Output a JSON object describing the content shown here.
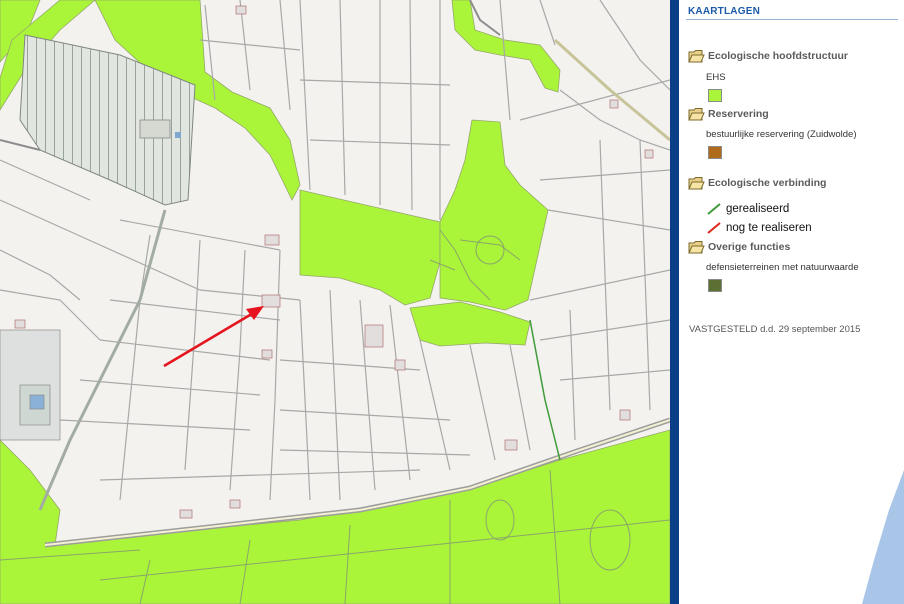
{
  "panel": {
    "title": "KAARTLAGEN",
    "groups": [
      {
        "label": "Ecologische hoofdstructuur",
        "items": [
          {
            "label": "EHS",
            "color": "#aaf53a"
          }
        ]
      },
      {
        "label": "Reservering",
        "items": [
          {
            "label": "bestuurlijke reservering (Zuidwolde)",
            "color": "#b06a1c"
          }
        ]
      },
      {
        "label": "Ecologische verbinding",
        "items": [
          {
            "label": "gerealiseerd",
            "color": "#3f9b3a"
          },
          {
            "label": "nog te realiseren",
            "color": "#e0241b"
          }
        ]
      },
      {
        "label": "Overige functies",
        "items": [
          {
            "label": "defensieterreinen met natuurwaarde",
            "color": "#5c7034"
          }
        ]
      }
    ],
    "status": "VASTGESTELD d.d. 29 september 2015"
  },
  "colors": {
    "map_background": "#f3f2ef",
    "ehs_fill": "#aaf53a",
    "parcel_line": "#a8a8a8",
    "road": "#8c8c8c",
    "divider": "#0a3f87",
    "water": "#a9c6e8",
    "annotation_arrow": "#e5141e"
  },
  "icons": {
    "group_icon": "folder-open-icon",
    "annotation": "red-arrow-icon"
  }
}
